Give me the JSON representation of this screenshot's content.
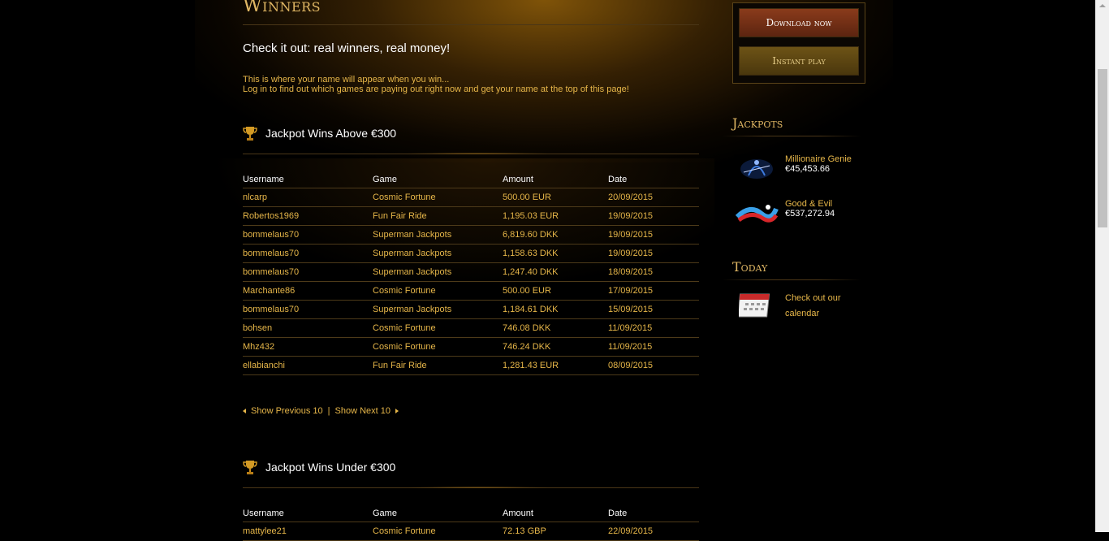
{
  "page": {
    "title": "Winners",
    "tagline": "Check it out: real winners, real money!",
    "intro_line1": "This is where your name will appear when you win...",
    "intro_line2": "Log in to find out which games are paying out right now and get your name at the top of this page!"
  },
  "columns": {
    "username": "Username",
    "game": "Game",
    "amount": "Amount",
    "date": "Date"
  },
  "above": {
    "title": "Jackpot Wins Above €300",
    "rows": [
      {
        "username": "nlcarp",
        "game": "Cosmic Fortune",
        "amount": "500.00 EUR",
        "date": "20/09/2015"
      },
      {
        "username": "Robertos1969",
        "game": "Fun Fair Ride",
        "amount": "1,195.03 EUR",
        "date": "19/09/2015"
      },
      {
        "username": "bommelaus70",
        "game": "Superman Jackpots",
        "amount": "6,819.60 DKK",
        "date": "19/09/2015"
      },
      {
        "username": "bommelaus70",
        "game": "Superman Jackpots",
        "amount": "1,158.63 DKK",
        "date": "19/09/2015"
      },
      {
        "username": "bommelaus70",
        "game": "Superman Jackpots",
        "amount": "1,247.40 DKK",
        "date": "18/09/2015"
      },
      {
        "username": "Marchante86",
        "game": "Cosmic Fortune",
        "amount": "500.00 EUR",
        "date": "17/09/2015"
      },
      {
        "username": "bommelaus70",
        "game": "Superman Jackpots",
        "amount": "1,184.61 DKK",
        "date": "15/09/2015"
      },
      {
        "username": "bohsen",
        "game": "Cosmic Fortune",
        "amount": "746.08 DKK",
        "date": "11/09/2015"
      },
      {
        "username": "Mhz432",
        "game": "Cosmic Fortune",
        "amount": "746.24 DKK",
        "date": "11/09/2015"
      },
      {
        "username": "ellabianchi",
        "game": "Fun Fair Ride",
        "amount": "1,281.43 EUR",
        "date": "08/09/2015"
      }
    ]
  },
  "pager": {
    "prev": "Show Previous 10",
    "separator": "|",
    "next": "Show Next 10"
  },
  "under": {
    "title": "Jackpot Wins Under €300",
    "rows": [
      {
        "username": "mattylee21",
        "game": "Cosmic Fortune",
        "amount": "72.13 GBP",
        "date": "22/09/2015"
      }
    ]
  },
  "sidebar": {
    "download_label": "Download now",
    "instant_label": "Instant play",
    "jackpots_title": "Jackpots",
    "jackpots": [
      {
        "name": "Millionaire Genie",
        "value": "€45,453.66",
        "thumb_text": "Millionaire Genie"
      },
      {
        "name": "Good & Evil",
        "value": "€537,272.94",
        "thumb_text": "Good & Evil"
      }
    ],
    "today_title": "Today",
    "calendar_text": "Check out our calendar"
  },
  "colors": {
    "gold": "#e6b649",
    "heading_gold": "#e0b764",
    "download_red": "#8a3b1b",
    "instant_olive": "#6d5316"
  }
}
